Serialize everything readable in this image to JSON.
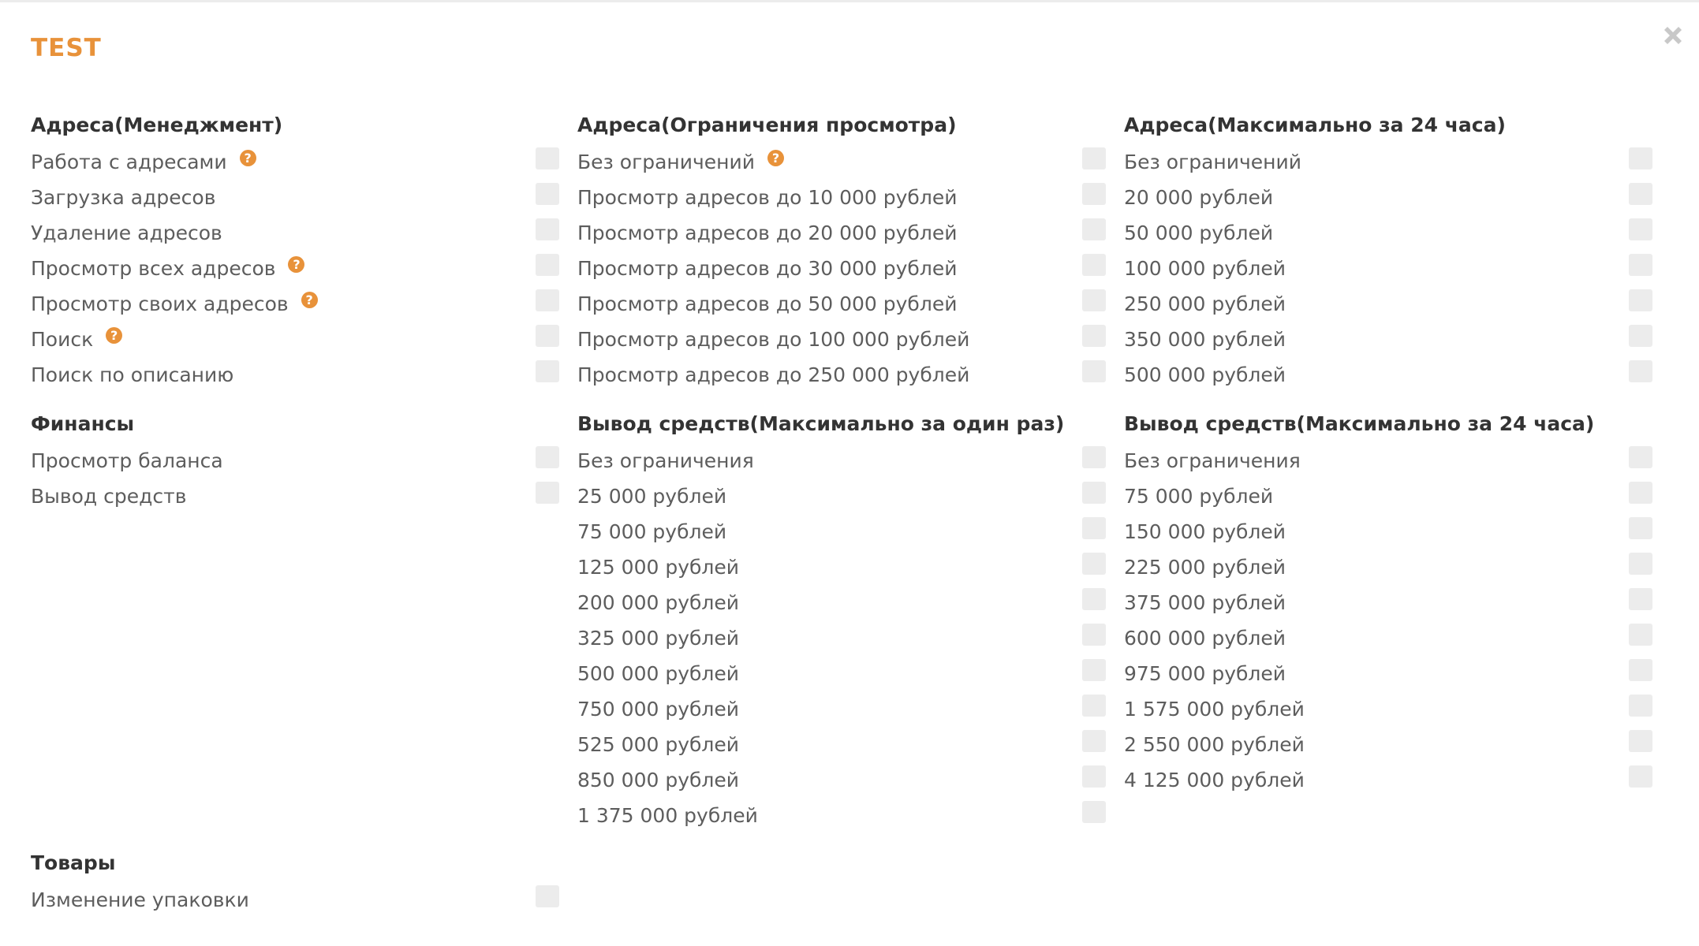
{
  "modal": {
    "title": "TEST"
  },
  "sections": {
    "addr_mgmt": {
      "title": "Адреса(Менеджмент)",
      "items": [
        {
          "label": "Работа с адресами",
          "help": "?"
        },
        {
          "label": "Загрузка адресов"
        },
        {
          "label": "Удаление адресов"
        },
        {
          "label": "Просмотр всех адресов",
          "help": "?"
        },
        {
          "label": "Просмотр своих адресов",
          "help": "?"
        },
        {
          "label": "Поиск",
          "help": "?"
        },
        {
          "label": "Поиск по описанию"
        }
      ]
    },
    "addr_view": {
      "title": "Адреса(Ограничения просмотра)",
      "items": [
        {
          "label": "Без ограничений",
          "help": "?"
        },
        {
          "label": "Просмотр адресов до 10 000 рублей"
        },
        {
          "label": "Просмотр адресов до 20 000 рублей"
        },
        {
          "label": "Просмотр адресов до 30 000 рублей"
        },
        {
          "label": "Просмотр адресов до 50 000 рублей"
        },
        {
          "label": "Просмотр адресов до 100 000 рублей"
        },
        {
          "label": "Просмотр адресов до 250 000 рублей"
        }
      ]
    },
    "addr_24h": {
      "title": "Адреса(Максимально за 24 часа)",
      "items": [
        {
          "label": "Без ограничений"
        },
        {
          "label": "20 000 рублей"
        },
        {
          "label": "50 000 рублей"
        },
        {
          "label": "100 000 рублей"
        },
        {
          "label": "250 000 рублей"
        },
        {
          "label": "350 000 рублей"
        },
        {
          "label": "500 000 рублей"
        }
      ]
    },
    "finance": {
      "title": "Финансы",
      "items": [
        {
          "label": "Просмотр баланса"
        },
        {
          "label": "Вывод средств"
        }
      ]
    },
    "withdraw_once": {
      "title": "Вывод средств(Максимально за один раз)",
      "items": [
        {
          "label": "Без ограничения"
        },
        {
          "label": "25 000 рублей"
        },
        {
          "label": "75 000 рублей"
        },
        {
          "label": "125 000 рублей"
        },
        {
          "label": "200 000 рублей"
        },
        {
          "label": "325 000 рублей"
        },
        {
          "label": "500 000 рублей"
        },
        {
          "label": "750 000 рублей"
        },
        {
          "label": "525 000 рублей"
        },
        {
          "label": "850 000 рублей"
        },
        {
          "label": "1 375 000 рублей"
        }
      ]
    },
    "withdraw_24h": {
      "title": "Вывод средств(Максимально за 24 часа)",
      "items": [
        {
          "label": "Без ограничения"
        },
        {
          "label": "75 000 рублей"
        },
        {
          "label": "150 000 рублей"
        },
        {
          "label": "225 000 рублей"
        },
        {
          "label": "375 000 рублей"
        },
        {
          "label": "600 000 рублей"
        },
        {
          "label": "975 000 рублей"
        },
        {
          "label": "1 575 000 рублей"
        },
        {
          "label": "2 550 000 рублей"
        },
        {
          "label": "4 125 000 рублей"
        }
      ]
    },
    "goods": {
      "title": "Товары",
      "items": [
        {
          "label": "Изменение упаковки"
        }
      ]
    }
  },
  "colors": {
    "accent": "#e8923a",
    "checkbox": "#ececec",
    "heading": "#333333",
    "text": "#5d5d5d"
  },
  "icons": {
    "close": "close-icon",
    "help": "help-icon"
  }
}
